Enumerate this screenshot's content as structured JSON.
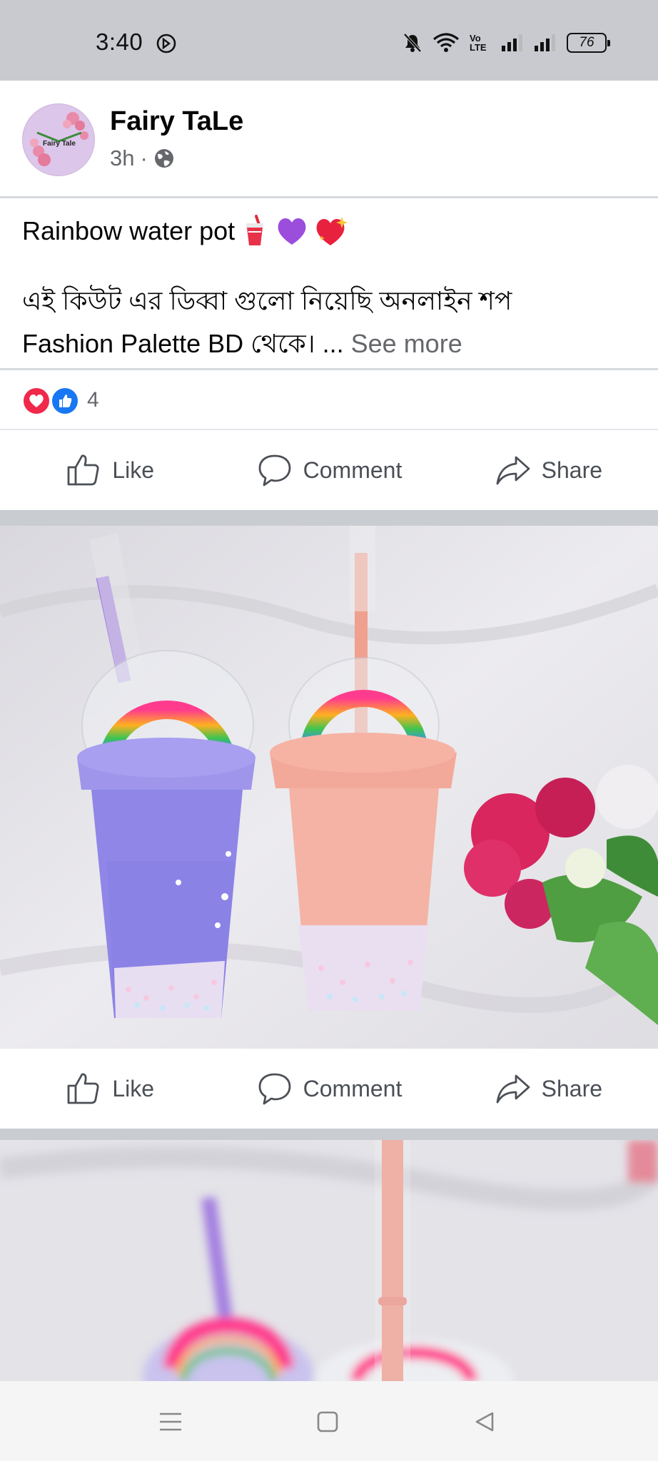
{
  "status_bar": {
    "time": "3:40",
    "volte_label": "Vo LTE",
    "battery_level": "76",
    "icons": [
      "do-not-disturb-icon",
      "mute-icon",
      "wifi-icon",
      "signal-icon",
      "signal-icon",
      "battery-icon"
    ]
  },
  "post": {
    "page_name": "Fairy TaLe",
    "avatar_text": "Fairy Tale",
    "time_ago": "3h",
    "separator": "·",
    "audience_icon": "globe-icon",
    "text_line1": "Rainbow water pot",
    "emojis": [
      "cup-with-straw",
      "purple-heart",
      "sparkling-heart"
    ],
    "text_line2": "এই কিউট এর ডিব্বা গুলো নিয়েছি অনলাইন শপ",
    "text_line3": "Fashion Palette BD থেকে। ...",
    "see_more": "See more",
    "reaction_count": "4",
    "reaction_icons": [
      "love-reaction-icon",
      "like-reaction-icon"
    ]
  },
  "actions": {
    "like": "Like",
    "comment": "Comment",
    "share": "Share"
  },
  "photo_actions": {
    "like": "Like",
    "comment": "Comment",
    "share": "Share"
  },
  "colors": {
    "accent_blue": "#1877f2",
    "love_red": "#f0284a",
    "meta_gray": "#65676b",
    "feed_background": "#c9ccd1"
  },
  "nav_bar": {
    "icons": [
      "menu-icon",
      "home-square-icon",
      "back-triangle-icon"
    ]
  }
}
